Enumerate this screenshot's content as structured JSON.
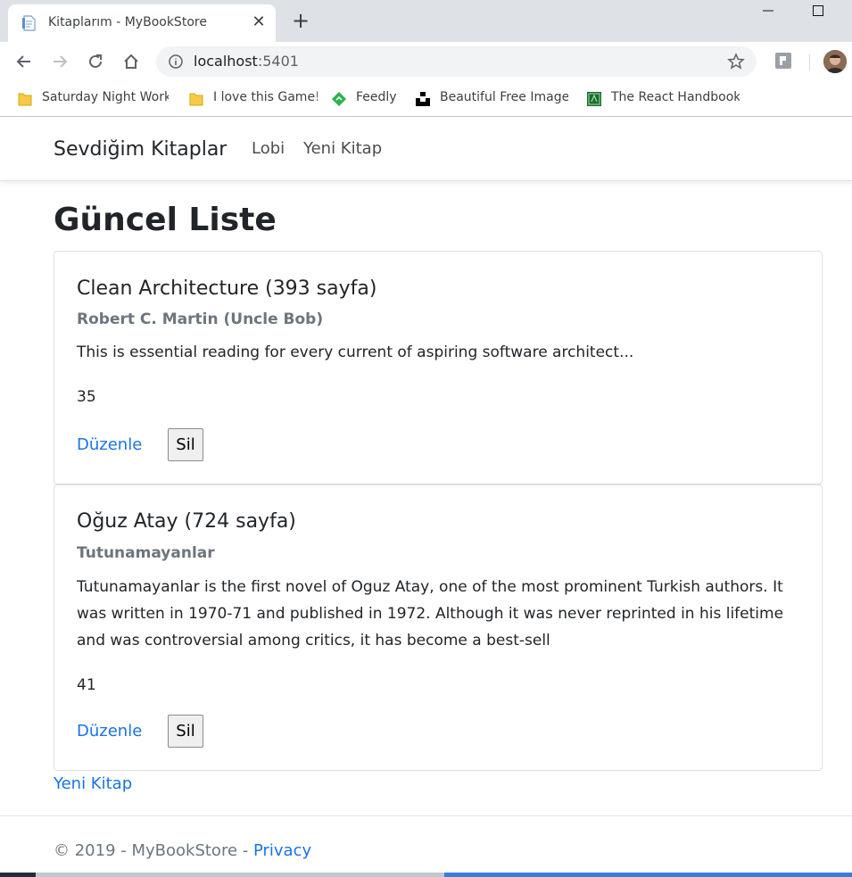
{
  "browser": {
    "tab_title": "Kitaplarım - MyBookStore",
    "url_host": "localhost",
    "url_port": ":5401",
    "bookmarks": [
      {
        "label": "Saturday Night Works",
        "icon": "folder-icon"
      },
      {
        "label": "I love this Game!",
        "icon": "folder-icon"
      },
      {
        "label": "Feedly",
        "icon": "feedly-icon"
      },
      {
        "label": "Beautiful Free Images",
        "icon": "unsplash-icon"
      },
      {
        "label": "The React Handbook",
        "icon": "book-icon"
      }
    ]
  },
  "navbar": {
    "brand": "Sevdiğim Kitaplar",
    "links": [
      "Lobi",
      "Yeni Kitap"
    ]
  },
  "main": {
    "title": "Güncel Liste",
    "books": [
      {
        "title": "Clean Architecture (393 sayfa)",
        "subtitle": "Robert C. Martin (Uncle Bob)",
        "text": "This is essential reading for every current of aspiring software architect...",
        "count": "35",
        "edit_label": "Düzenle",
        "delete_label": "Sil"
      },
      {
        "title": "Oğuz Atay (724 sayfa)",
        "subtitle": "Tutunamayanlar",
        "text": "Tutunamayanlar is the first novel of Oguz Atay, one of the most prominent Turkish authors. It was written in 1970-71 and published in 1972. Although it was never reprinted in his lifetime and was controversial among critics, it has become a best-sell",
        "count": "41",
        "edit_label": "Düzenle",
        "delete_label": "Sil"
      }
    ],
    "new_book_link": "Yeni Kitap"
  },
  "footer": {
    "text": "© 2019 - MyBookStore - ",
    "privacy_link": "Privacy"
  },
  "colors": {
    "link": "#1a73e8",
    "muted": "#6c757d",
    "text": "#212529"
  }
}
